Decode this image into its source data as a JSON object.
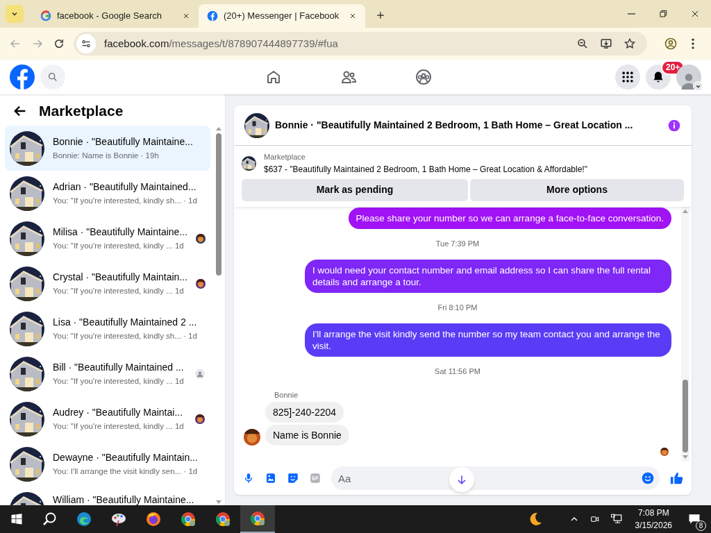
{
  "browser": {
    "tabs": [
      {
        "title": "facebook - Google Search",
        "kind": "google",
        "selected": false
      },
      {
        "title": "(20+) Messenger | Facebook",
        "kind": "facebook",
        "selected": true
      }
    ],
    "url_host": "facebook.com",
    "url_path": "/messages/t/878907444897739/#fua"
  },
  "facebook_header": {
    "notification_badge": "20+"
  },
  "sidebar": {
    "title": "Marketplace",
    "conversations": [
      {
        "title": "Bonnie · \"Beautifully Maintaine...",
        "preview": "Bonnie: Name is Bonnie · 19h",
        "selected": true,
        "kind": "plain"
      },
      {
        "title": "Adrian · \"Beautifully Maintained...",
        "preview": "You: \"If you're interested, kindly sh... · 1d",
        "selected": false,
        "kind": "plain"
      },
      {
        "title": "Milisa · \"Beautifully Maintaine...",
        "preview": "You: \"If you're interested, kindly ...  1d",
        "selected": false,
        "kind": "seenphoto"
      },
      {
        "title": "Crystal · \"Beautifully Maintain...",
        "preview": "You: \"If you're interested, kindly ...  1d",
        "selected": false,
        "kind": "seenphoto"
      },
      {
        "title": "Lisa · \"Beautifully Maintained 2 ...",
        "preview": "You: \"If you're interested, kindly sh... · 1d",
        "selected": false,
        "kind": "plain"
      },
      {
        "title": "Bill · \"Beautifully Maintained ...",
        "preview": "You: \"If you're interested, kindly ...  1d",
        "selected": false,
        "kind": "seendefault"
      },
      {
        "title": "Audrey · \"Beautifully Maintai...",
        "preview": "You: \"If you're interested, kindly ...  1d",
        "selected": false,
        "kind": "seenphoto"
      },
      {
        "title": "Dewayne · \"Beautifully Maintain...",
        "preview": "You: I'll arrange the visit kindly sen... · 1d",
        "selected": false,
        "kind": "plain"
      },
      {
        "title": "William · \"Beautifully Maintaine...",
        "selected": false,
        "kind": "plain"
      }
    ]
  },
  "chat": {
    "title": "Bonnie · \"Beautifully Maintained 2 Bedroom, 1 Bath Home – Great Location ...",
    "listing": {
      "label": "Marketplace",
      "description": "$637 - \"Beautifully Maintained 2 Bedroom, 1 Bath Home – Great Location & Affordable!\""
    },
    "buttons": [
      "Mark as pending",
      "More options"
    ],
    "messages": [
      {
        "kind": "outgoing",
        "text": "Please share your number so we can arrange a face-to-face conversation."
      },
      {
        "kind": "timestamp",
        "text": "Tue 7:39 PM"
      },
      {
        "kind": "outgoing",
        "text": "I would need your contact number and email address so I can share the full rental details and arrange a tour."
      },
      {
        "kind": "timestamp",
        "text": "Fri 8:10 PM"
      },
      {
        "kind": "outgoing",
        "text": "I'll arrange the visit kindly send the number so my team contact you and arrange the visit."
      },
      {
        "kind": "timestamp",
        "text": "Sat 11:56 PM"
      },
      {
        "kind": "incoming",
        "sender": "Bonnie",
        "texts": [
          "825]-240-2204",
          "Name is Bonnie"
        ]
      }
    ],
    "composer": {
      "placeholder": "Aa"
    }
  },
  "taskbar": {
    "time": "7:08 PM",
    "date": "3/15/2026",
    "notification_count": "8"
  }
}
